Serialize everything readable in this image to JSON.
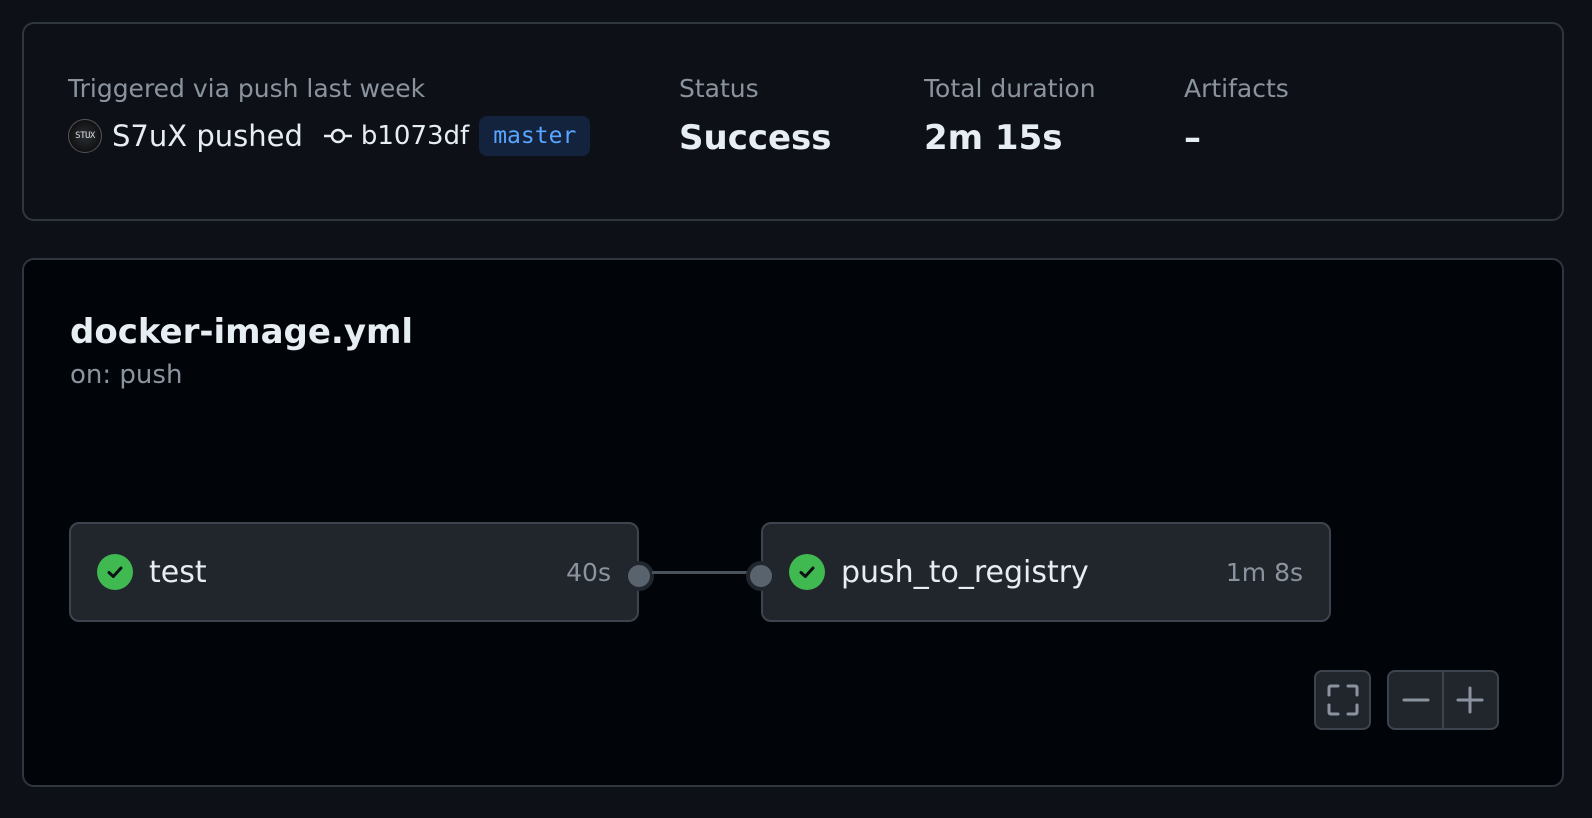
{
  "run": {
    "trigger_label": "Triggered via push last week",
    "avatar_text": "STUX",
    "actor_text": "S7uX pushed",
    "commit_sha": "b1073df",
    "branch": "master",
    "status_label": "Status",
    "status_value": "Success",
    "duration_label": "Total duration",
    "duration_value": "2m 15s",
    "artifacts_label": "Artifacts",
    "artifacts_value": "–"
  },
  "workflow": {
    "file": "docker-image.yml",
    "trigger": "on: push",
    "jobs": [
      {
        "name": "test",
        "duration": "40s",
        "status": "success"
      },
      {
        "name": "push_to_registry",
        "duration": "1m 8s",
        "status": "success"
      }
    ]
  },
  "icons": {
    "commit": "git-commit-icon",
    "job_status": "check-circle-icon",
    "fullscreen": "fullscreen-icon",
    "zoom_out": "minus-icon",
    "zoom_in": "plus-icon"
  },
  "colors": {
    "success": "#3fb950",
    "branch_text": "#58a6ff",
    "branch_bg": "#14233d",
    "background": "#0d1117",
    "graph_background": "#010409"
  }
}
